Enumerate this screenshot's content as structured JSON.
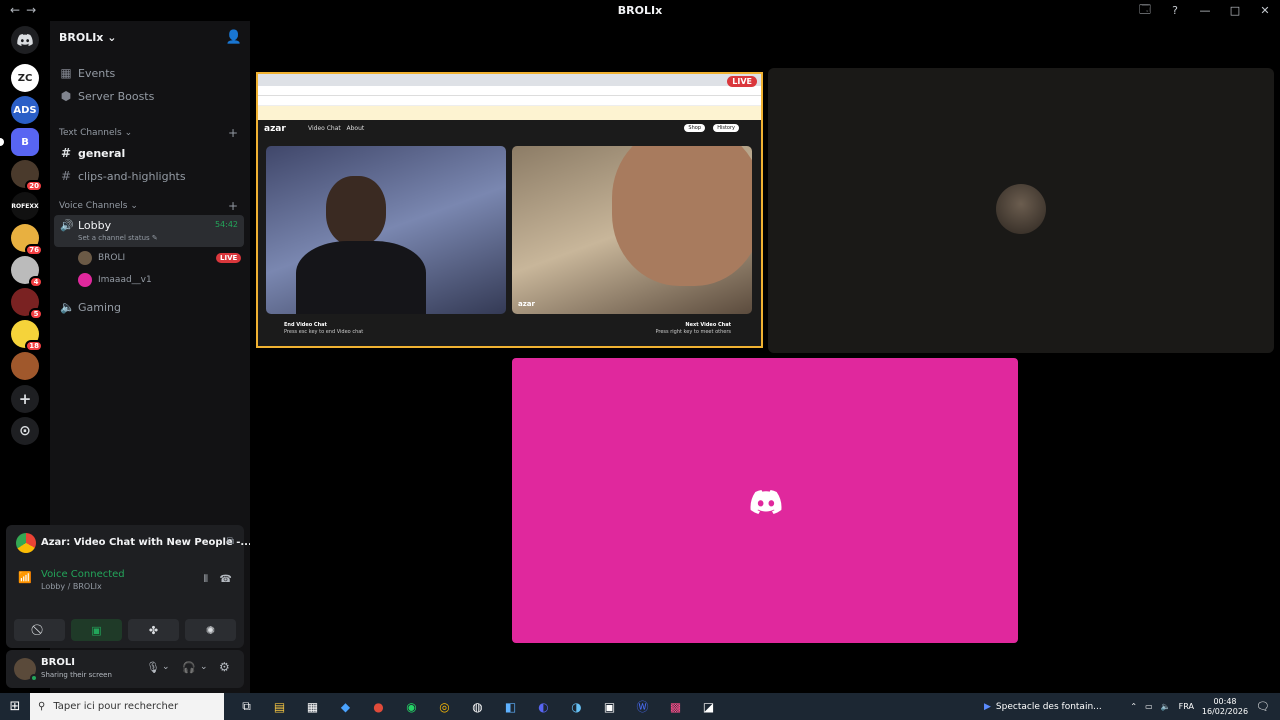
{
  "window": {
    "title": "BROLIx",
    "nav_back": "←",
    "nav_forward": "→",
    "controls": [
      "🗔",
      "?",
      "—",
      "□",
      "✕"
    ]
  },
  "rail": {
    "home_icon": "discord-logo",
    "servers": [
      {
        "label": "ZC",
        "color": "#ffffff",
        "text_color": "#222222",
        "badge": ""
      },
      {
        "label": "ADS",
        "color": "#2b5fc7",
        "text_color": "#ffffff",
        "badge": ""
      },
      {
        "label": "B",
        "color": "#5865f2",
        "text_color": "#ffffff",
        "badge": ""
      },
      {
        "label": "",
        "color": "#4a3a2c",
        "text_color": "#ffffff",
        "badge": "20"
      },
      {
        "label": "ROFEXX",
        "color": "#111111",
        "text_color": "#ffffff",
        "badge": ""
      },
      {
        "label": "",
        "color": "#e8b040",
        "text_color": "#ffffff",
        "badge": "76"
      },
      {
        "label": "",
        "color": "#bbbbbb",
        "text_color": "#ffffff",
        "badge": "4"
      },
      {
        "label": "",
        "color": "#7a2222",
        "text_color": "#ffffff",
        "badge": "5"
      },
      {
        "label": "",
        "color": "#f5d33a",
        "text_color": "#ffffff",
        "badge": "18"
      },
      {
        "label": "",
        "color": "#a0582c",
        "text_color": "#ffffff",
        "badge": ""
      }
    ],
    "add_server": "+",
    "discover": "⊙"
  },
  "sidebar": {
    "server_name": "BROLIx",
    "events": "Events",
    "boosts": "Server Boosts",
    "text_category": "Text Channels",
    "text_channels": [
      "general",
      "clips-and-highlights"
    ],
    "voice_category": "Voice Channels",
    "lobby": {
      "name": "Lobby",
      "timer": "54:42",
      "status": "Set a channel status"
    },
    "voice_users": [
      {
        "name": "BROLI",
        "live": "LIVE"
      },
      {
        "name": "Imaaad__v1",
        "live": ""
      }
    ],
    "gaming": "Gaming"
  },
  "activity": {
    "title": "Azar: Video Chat with New People -...",
    "voice_connected": "Voice Connected",
    "voice_channel": "Lobby / BROLIx"
  },
  "user": {
    "name": "BROLI",
    "status": "Sharing their screen"
  },
  "stage": {
    "live_badge": "LIVE",
    "azar": {
      "logo": "azar",
      "nav_items": [
        "Video Chat",
        "About"
      ],
      "shop": "Shop",
      "history": "History",
      "end_chat": "End Video Chat",
      "end_chat_sub": "Press esc key to end Video chat",
      "next_chat": "Next Video Chat",
      "next_chat_sub": "Press right key to meet others"
    }
  },
  "taskbar": {
    "search_placeholder": "Taper ici pour rechercher",
    "media_title": "Spectacle des fontain...",
    "language": "FRA",
    "time": "00:48",
    "date": "16/02/2026"
  },
  "colors": {
    "accent_pink": "#e0289d",
    "voice_green": "#23a55a",
    "live_red": "#da373c"
  }
}
